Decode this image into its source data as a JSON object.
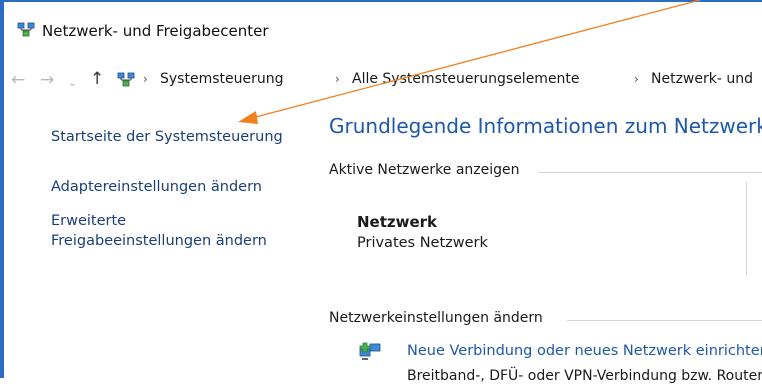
{
  "window": {
    "title": "Netzwerk- und Freigabecenter",
    "title_icon": "network-sharing-icon"
  },
  "nav": {
    "back": "←",
    "forward": "→",
    "recent": "⌄",
    "up": "↑"
  },
  "breadcrumb": {
    "sep": "›",
    "items": [
      "Systemsteuerung",
      "Alle Systemsteuerungselemente",
      "Netzwerk- und"
    ]
  },
  "sidebar": {
    "items": [
      {
        "label": "Startseite der Systemsteuerung"
      },
      {
        "label": "Adaptereinstellungen ändern"
      },
      {
        "label_line1": "Erweiterte",
        "label_line2": "Freigabeeinstellungen ändern"
      }
    ]
  },
  "main": {
    "title": "Grundlegende Informationen zum Netzwerk",
    "active_networks_label": "Aktive Netzwerke anzeigen",
    "network": {
      "name": "Netzwerk",
      "type": "Privates Netzwerk"
    },
    "settings_label": "Netzwerkeinstellungen ändern",
    "task": {
      "link": "Neue Verbindung oder neues Netzwerk einrichten",
      "desc": "Breitband-, DFÜ- oder VPN-Verbindung bzw. Router"
    }
  },
  "annotation": {
    "arrow_color": "#f08020"
  }
}
